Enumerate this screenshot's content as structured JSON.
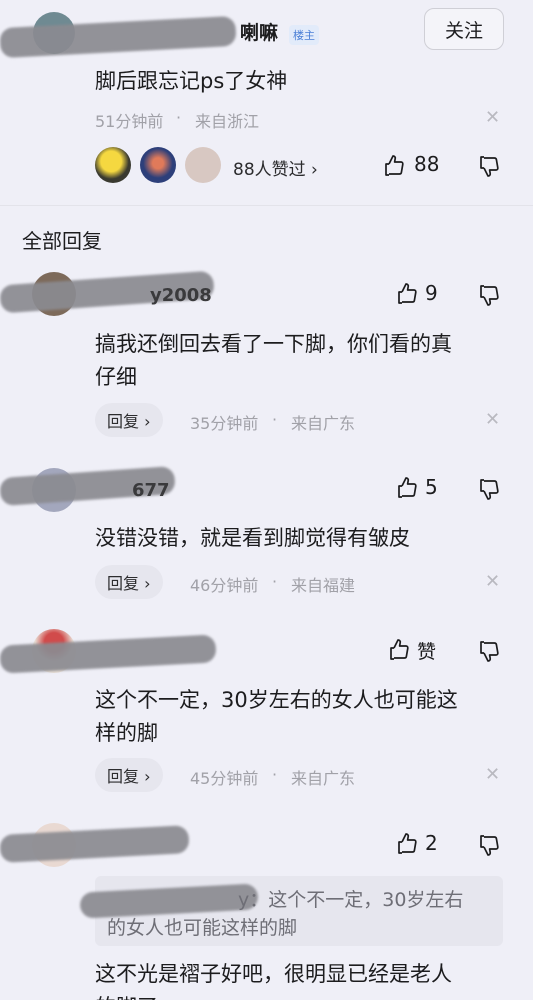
{
  "top_post": {
    "name_suffix": "喇嘛",
    "badge": "楼主",
    "follow_label": "关注",
    "text": "脚后跟忘记ps了女神",
    "time": "51分钟前",
    "location": "来自浙江",
    "likes_summary": "88人赞过 ›",
    "like_count": "88"
  },
  "section_title": "全部回复",
  "comments": [
    {
      "name_visible": "y2008",
      "like_count": "9",
      "text_line1": "搞我还倒回去看了一下脚，你们看的真",
      "text_line2": "仔细",
      "reply_label": "回复 ›",
      "time": "35分钟前",
      "location": "来自广东"
    },
    {
      "name_visible": "677",
      "like_count": "5",
      "text_line1": "没错没错，就是看到脚觉得有皱皮",
      "reply_label": "回复 ›",
      "time": "46分钟前",
      "location": "来自福建"
    },
    {
      "name_visible": "",
      "like_count": "赞",
      "text_line1": "这个不一定，30岁左右的女人也可能这",
      "text_line2": "样的脚",
      "reply_label": "回复 ›",
      "time": "45分钟前",
      "location": "来自广东"
    },
    {
      "name_visible": "",
      "like_count": "2",
      "quote_line1": "y：这个不一定，30岁左右",
      "quote_line2": "的女人也可能这样的脚",
      "text_line1": "这不光是褶子好吧，很明显已经是老人",
      "text_line2": "的脚了"
    }
  ],
  "icons": {
    "like": "thumbs-up-icon",
    "dislike": "thumbs-down-icon",
    "close": "close-icon",
    "chevron": "chevron-right-icon"
  }
}
